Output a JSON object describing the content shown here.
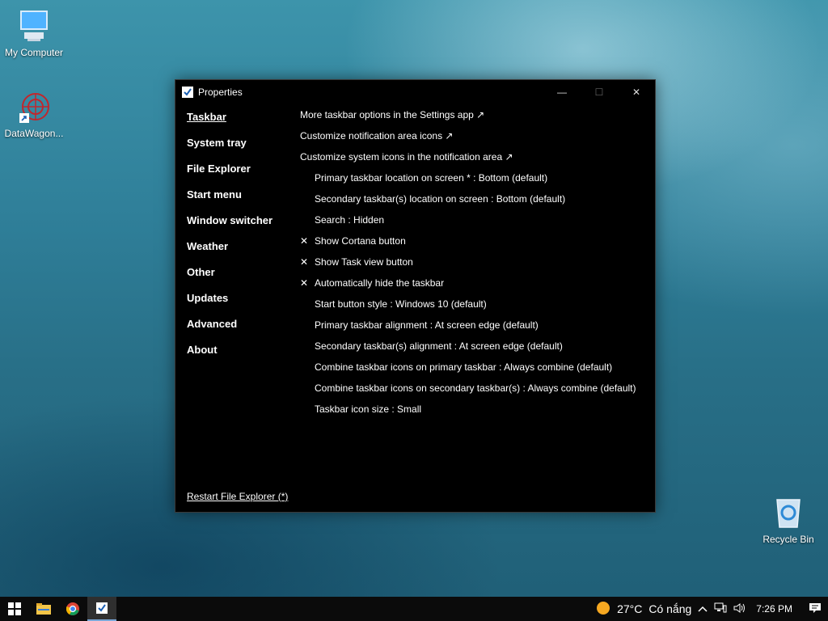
{
  "desktop": {
    "icons": [
      {
        "label": "My Computer",
        "icon": "computer-icon"
      },
      {
        "label": "DataWagon...",
        "icon": "datawagon-shortcut-icon"
      },
      {
        "label": "Recycle Bin",
        "icon": "recycle-bin-icon"
      }
    ]
  },
  "window": {
    "title": "Properties",
    "controls": {
      "minimize": "—",
      "maximize": "☐",
      "close": "✕"
    },
    "nav": [
      {
        "label": "Taskbar",
        "active": true
      },
      {
        "label": "System tray"
      },
      {
        "label": "File Explorer"
      },
      {
        "label": "Start menu"
      },
      {
        "label": "Window switcher"
      },
      {
        "label": "Weather"
      },
      {
        "label": "Other"
      },
      {
        "label": "Updates"
      },
      {
        "label": "Advanced"
      },
      {
        "label": "About"
      }
    ],
    "options": [
      {
        "text": "More taskbar options in the Settings app ↗"
      },
      {
        "text": "Customize notification area icons ↗"
      },
      {
        "text": "Customize system icons in the notification area ↗"
      },
      {
        "text": "Primary taskbar location on screen * : Bottom (default)"
      },
      {
        "text": "Secondary taskbar(s) location on screen : Bottom (default)"
      },
      {
        "text": "Search : Hidden"
      },
      {
        "text": "Show Cortana button",
        "mark": "✕"
      },
      {
        "text": "Show Task view button",
        "mark": "✕"
      },
      {
        "text": "Automatically hide the taskbar",
        "mark": "✕"
      },
      {
        "text": "Start button style : Windows 10 (default)"
      },
      {
        "text": "Primary taskbar alignment : At screen edge (default)"
      },
      {
        "text": "Secondary taskbar(s) alignment : At screen edge (default)"
      },
      {
        "text": "Combine taskbar icons on primary taskbar : Always combine (default)"
      },
      {
        "text": "Combine taskbar icons on secondary taskbar(s) : Always combine (default)"
      },
      {
        "text": "Taskbar icon size : Small"
      }
    ],
    "restart_label": "Restart File Explorer (*)"
  },
  "taskbar": {
    "apps": [
      "windows-start-icon",
      "file-explorer-icon",
      "chrome-icon",
      "properties-app-icon"
    ],
    "weather": {
      "temp": "27°C",
      "condition": "Có nắng"
    },
    "time": "7:26 PM"
  }
}
